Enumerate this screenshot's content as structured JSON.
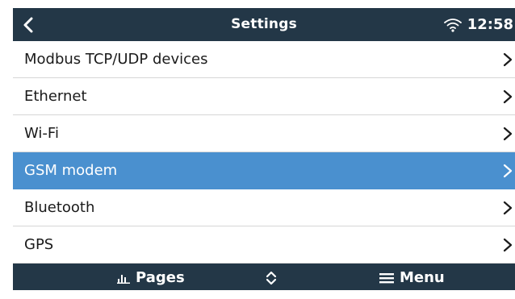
{
  "header": {
    "title": "Settings",
    "time": "12:58",
    "back_icon": "chevron-left-icon",
    "wifi_icon": "wifi-icon"
  },
  "list": {
    "items": [
      {
        "label": "Modbus TCP/UDP devices",
        "selected": false
      },
      {
        "label": "Ethernet",
        "selected": false
      },
      {
        "label": "Wi-Fi",
        "selected": false
      },
      {
        "label": "GSM modem",
        "selected": true
      },
      {
        "label": "Bluetooth",
        "selected": false
      },
      {
        "label": "GPS",
        "selected": false
      }
    ]
  },
  "footer": {
    "pages_label": "Pages",
    "menu_label": "Menu",
    "pages_icon": "bar-chart-icon",
    "updown_icon": "up-down-icon",
    "menu_icon": "hamburger-icon"
  },
  "colors": {
    "header_bg": "#233747",
    "selected_bg": "#4a90cf",
    "text": "#1a1a1a"
  }
}
